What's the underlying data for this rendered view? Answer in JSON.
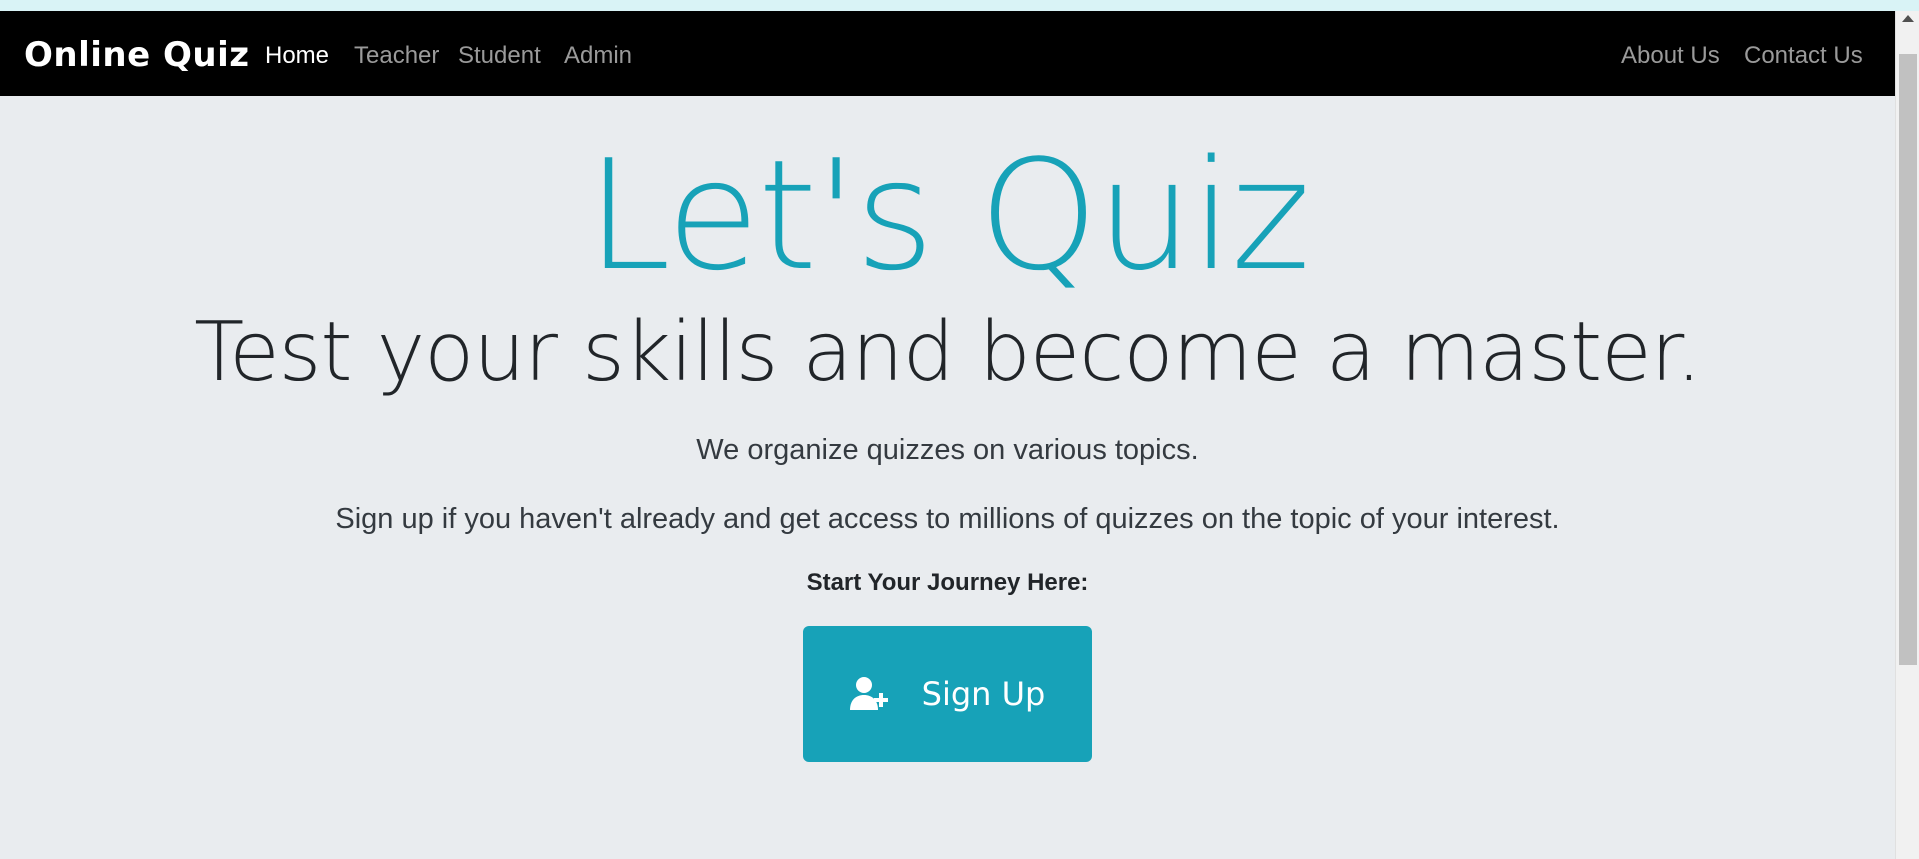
{
  "navbar": {
    "brand": "Online Quiz",
    "left_links": [
      "Home",
      "Teacher",
      "Student",
      "Admin"
    ],
    "active_link": "Home",
    "right_links": [
      "About Us",
      "Contact Us"
    ]
  },
  "hero": {
    "title": "Let's Quiz",
    "subtitle": "Test your skills and become a master.",
    "lead_1": "We organize quizzes on various topics.",
    "lead_2": "Sign up if you haven't already and get access to millions of quizzes on the topic of your interest.",
    "journey_label": "Start Your Journey Here:",
    "signup_button": {
      "label": "Sign Up",
      "icon": "user-plus-icon"
    }
  },
  "colors": {
    "navbar_bg": "#000000",
    "page_bg": "#e9ecef",
    "accent": "#17a2b8",
    "nav_active": "#ffffff",
    "nav_inactive": "#9a9a9a"
  }
}
